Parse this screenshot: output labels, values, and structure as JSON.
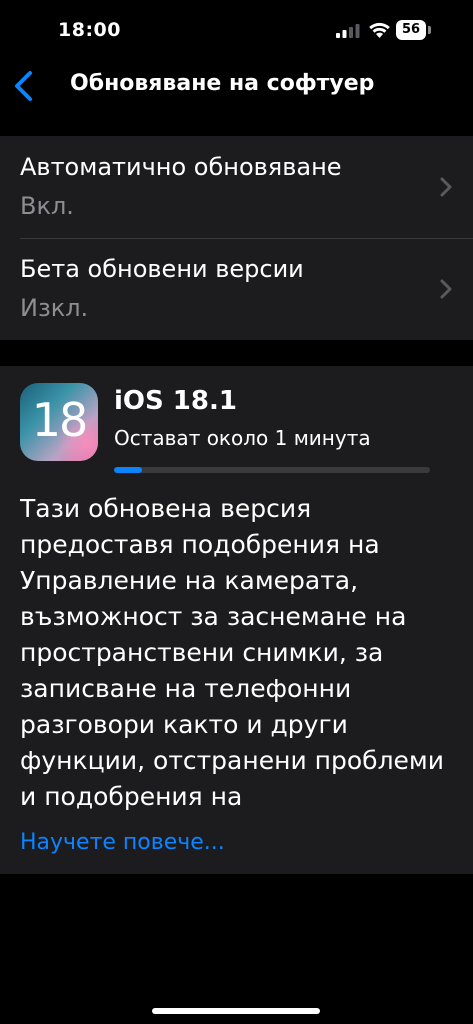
{
  "status_bar": {
    "time": "18:00",
    "battery_level": "56",
    "signal_icon": "cellular-signal-icon",
    "wifi_icon": "wifi-icon",
    "battery_icon": "battery-icon"
  },
  "nav": {
    "back_icon": "chevron-left-icon",
    "title": "Обновяване на софтуер"
  },
  "settings": {
    "rows": [
      {
        "title": "Автоматично обновяване",
        "value": "Вкл.",
        "icon": "chevron-right-icon"
      },
      {
        "title": "Бета обновени версии",
        "value": "Изкл.",
        "icon": "chevron-right-icon"
      }
    ]
  },
  "update": {
    "icon": "ios-18-app-icon",
    "icon_number": "18",
    "name": "iOS 18.1",
    "status": "Остават около 1 минута",
    "progress_fraction": 0.09,
    "description": "Тази обновена версия предоставя подобрения на Управление на камерата, възможност за заснемане на пространствени снимки, за записване на телефонни разговори както и други функции, отстранени проблеми и подобрения на",
    "learn_more": "Научете повече..."
  },
  "colors": {
    "accent": "#0a84ff",
    "background": "#000000",
    "card_background": "#1c1c1e",
    "secondary_text": "#8d8d93"
  }
}
